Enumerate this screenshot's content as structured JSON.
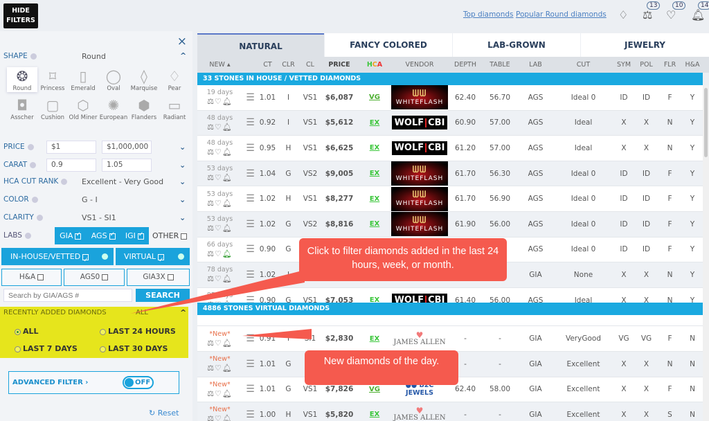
{
  "header": {
    "hide_filters": "HIDE FILTERS",
    "links": [
      "Top diamonds",
      "Popular Round diamonds"
    ],
    "counts": {
      "compare": "13",
      "favorites": "10",
      "alerts": "14"
    }
  },
  "filters": {
    "close": "×",
    "shape": {
      "label": "SHAPE",
      "value": "Round",
      "shapes": [
        "Round",
        "Princess",
        "Emerald",
        "Oval",
        "Marquise",
        "Pear",
        "Asscher",
        "Cushion",
        "Old Miner",
        "European",
        "Flanders",
        "Radiant"
      ]
    },
    "price": {
      "label": "PRICE",
      "min": "$1",
      "max": "$1,000,000"
    },
    "carat": {
      "label": "CARAT",
      "min": "0.9",
      "max": "1.05"
    },
    "hca": {
      "label": "HCA CUT RANK",
      "value": "Excellent - Very Good"
    },
    "color": {
      "label": "COLOR",
      "value": "G - I"
    },
    "clarity": {
      "label": "CLARITY",
      "value": "VS1 - SI1"
    },
    "labs": {
      "label": "LABS",
      "gia": "GIA",
      "ags": "AGS",
      "igi": "IGI",
      "other": "OTHER"
    },
    "inhouse": "IN-HOUSE/VETTED",
    "virtual": "VIRTUAL",
    "ha": "H&A",
    "ags0": "AGS0",
    "gia3x": "GIA3X",
    "search_placeholder": "Search by GIA/AGS #",
    "search_button": "SEARCH",
    "recent": {
      "label": "RECENTLY ADDED DIAMONDS",
      "value": "ALL",
      "options": [
        "ALL",
        "LAST 24 HOURS",
        "LAST 7 DAYS",
        "LAST 30 DAYS"
      ],
      "selected": "ALL"
    },
    "advanced": {
      "label": "ADVANCED FILTER",
      "toggle": "OFF"
    },
    "reset": "Reset"
  },
  "tabs": [
    "NATURAL",
    "FANCY COLORED",
    "LAB-GROWN",
    "JEWELRY"
  ],
  "active_tab": "NATURAL",
  "columns": [
    "NEW",
    "",
    "CT",
    "CLR",
    "CL",
    "PRICE",
    "HCA",
    "VENDOR",
    "DEPTH",
    "TABLE",
    "LAB",
    "CUT",
    "SYM",
    "POL",
    "FLR",
    "H&A"
  ],
  "sections": {
    "inhouse": "33  STONES  IN HOUSE  / VETTED DIAMONDS",
    "virtual": "4886  STONES  VIRTUAL  DIAMONDS"
  },
  "rows_inhouse": [
    [
      "19 days",
      "1.01",
      "I",
      "VS1",
      "$6,087",
      "VG",
      "WHITEFLASH",
      "62.40",
      "56.70",
      "AGS",
      "Ideal 0",
      "ID",
      "ID",
      "F",
      "Y"
    ],
    [
      "48 days",
      "0.92",
      "I",
      "VS1",
      "$5,612",
      "EX",
      "WOLF|CBI",
      "60.90",
      "57.00",
      "AGS",
      "Ideal",
      "X",
      "X",
      "N",
      "Y"
    ],
    [
      "48 days",
      "0.95",
      "H",
      "VS1",
      "$6,625",
      "EX",
      "WOLF|CBI",
      "61.20",
      "57.00",
      "AGS",
      "Ideal",
      "X",
      "X",
      "N",
      "Y"
    ],
    [
      "53 days",
      "1.04",
      "G",
      "VS2",
      "$9,005",
      "EX",
      "WHITEFLASH",
      "61.70",
      "56.30",
      "AGS",
      "Ideal 0",
      "ID",
      "ID",
      "F",
      "Y"
    ],
    [
      "53 days",
      "1.02",
      "H",
      "VS1",
      "$8,277",
      "EX",
      "WHITEFLASH",
      "61.70",
      "56.90",
      "AGS",
      "Ideal 0",
      "ID",
      "ID",
      "F",
      "Y"
    ],
    [
      "53 days",
      "1.02",
      "G",
      "VS2",
      "$8,816",
      "EX",
      "WHITEFLASH",
      "61.90",
      "56.00",
      "AGS",
      "Ideal 0",
      "ID",
      "ID",
      "F",
      "Y"
    ],
    [
      "66 days",
      "0.90",
      "G",
      "",
      "",
      "",
      "",
      "",
      "",
      "AGS",
      "Ideal 0",
      "ID",
      "ID",
      "F",
      "Y"
    ],
    [
      "78 days",
      "1.02",
      "I",
      "",
      "",
      "",
      "",
      "",
      "",
      "GIA",
      "None",
      "X",
      "X",
      "N",
      "Y"
    ],
    [
      "85 days",
      "0.90",
      "G",
      "VS1",
      "$7,053",
      "EX",
      "WOLF|CBI",
      "61.40",
      "56.00",
      "AGS",
      "Ideal",
      "X",
      "X",
      "N",
      "Y"
    ]
  ],
  "rows_virtual": [
    [
      "*New*",
      "0.91",
      "I",
      "SI1",
      "$2,830",
      "EX",
      "JAMES ALLEN",
      "-",
      "-",
      "GIA",
      "VeryGood",
      "VG",
      "VG",
      "F",
      "N"
    ],
    [
      "*New*",
      "1.01",
      "G",
      "",
      "",
      "",
      "",
      "-",
      "-",
      "GIA",
      "Excellent",
      "X",
      "X",
      "N",
      "N"
    ],
    [
      "*New*",
      "1.01",
      "G",
      "VS1",
      "$7,826",
      "VG",
      "B2C JEWELS",
      "62.40",
      "58.00",
      "GIA",
      "Excellent",
      "X",
      "X",
      "F",
      "N"
    ],
    [
      "*New*",
      "1.00",
      "H",
      "VS1",
      "$5,820",
      "EX",
      "JAMES ALLEN",
      "-",
      "-",
      "GIA",
      "Excellent",
      "X",
      "X",
      "S",
      "N"
    ]
  ],
  "callouts": [
    "Click to filter diamonds added in the last 24 hours, week, or month.",
    "New diamonds of the day."
  ],
  "colors": {
    "accent": "#1aa3dc",
    "highlight": "#e6e51c",
    "callout": "#f55a4e",
    "hca_ex": "#3bc63b"
  }
}
